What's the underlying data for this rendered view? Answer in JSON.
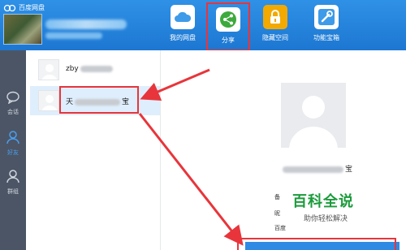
{
  "app": {
    "title": "百度网盘"
  },
  "nav": [
    {
      "id": "my-disk",
      "label": "我的网盘",
      "icon": "cloud-icon",
      "color": "#3d9be9"
    },
    {
      "id": "share",
      "label": "分享",
      "icon": "share-icon",
      "color": "#3caa3c"
    },
    {
      "id": "private",
      "label": "隐藏空间",
      "icon": "lock-icon",
      "color": "#f2a900"
    },
    {
      "id": "tools",
      "label": "功能宝箱",
      "icon": "tools-icon",
      "color": "#3d9be9"
    }
  ],
  "sidebar": [
    {
      "label": "会话",
      "icon": "chat-bubble-icon"
    },
    {
      "label": "好友",
      "icon": "friend-icon",
      "active": true
    },
    {
      "label": "群组",
      "icon": "group-icon"
    }
  ],
  "contacts": [
    {
      "name_prefix": "zby",
      "selected": false
    },
    {
      "name_prefix": "天",
      "name_suffix": "宝",
      "selected": true
    }
  ],
  "profile": {
    "name_suffix": "宝",
    "fields": [
      "备",
      "昵",
      "百度"
    ]
  },
  "watermark": {
    "main": "百科全说",
    "sub": "助你轻松解决"
  },
  "colors": {
    "header": "#1d77d2",
    "highlight": "#e8353b",
    "sidebar": "#4c5565"
  }
}
